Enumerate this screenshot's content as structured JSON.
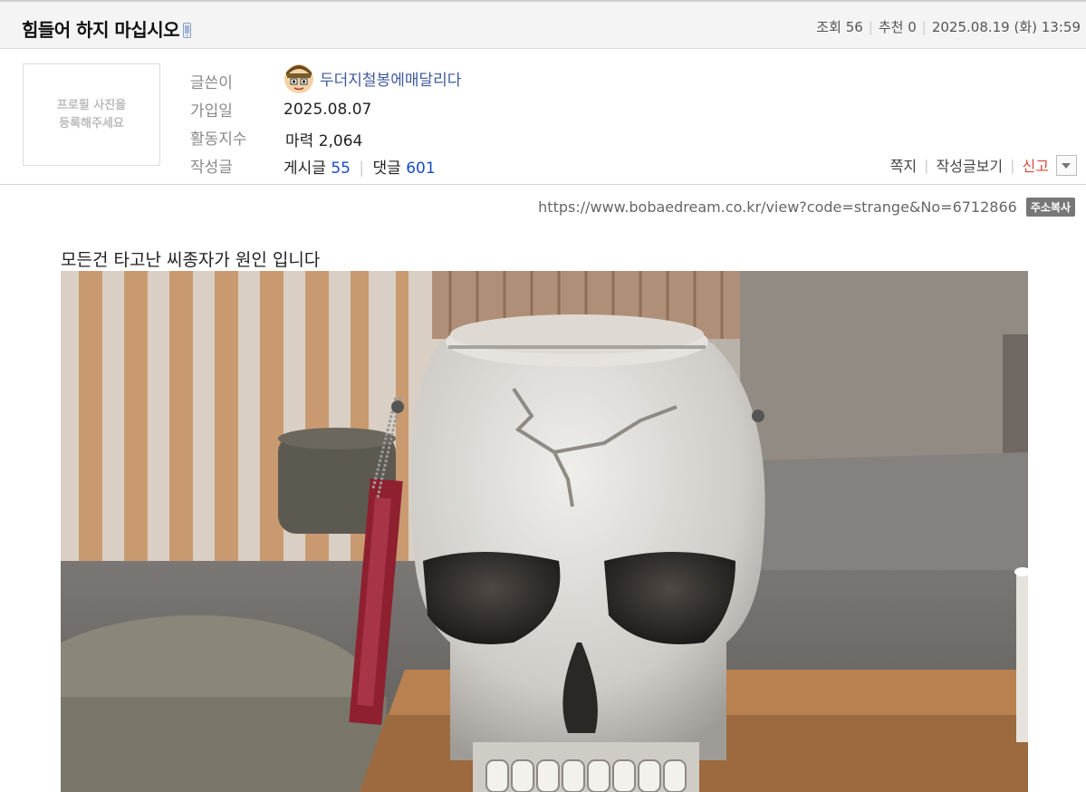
{
  "post": {
    "title": "힘들어 하지 마십시오",
    "views_label": "조회",
    "views": "56",
    "recommend_label": "추천",
    "recommend": "0",
    "datetime": "2025.08.19 (화) 13:59"
  },
  "profile": {
    "photo_placeholder_line1": "프로필 사진을",
    "photo_placeholder_line2": "등록해주세요",
    "author_label": "글쓴이",
    "author": "두더지철봉에매달리다",
    "joined_label": "가입일",
    "joined": "2025.08.07",
    "activity_label": "활동지수",
    "activity_name": "마력",
    "activity_value": "2,064",
    "posts_label": "작성글",
    "posts_name": "게시글",
    "posts_count": "55",
    "comments_name": "댓글",
    "comments_count": "601"
  },
  "actions": {
    "message": "쪽지",
    "view_posts": "작성글보기",
    "report": "신고"
  },
  "url": {
    "text": "https://www.bobaedream.co.kr/view?code=strange&No=6712866",
    "copy_label": "주소복사"
  },
  "content": {
    "text": "모든건 타고난 씨종자가 원인 입니다"
  }
}
